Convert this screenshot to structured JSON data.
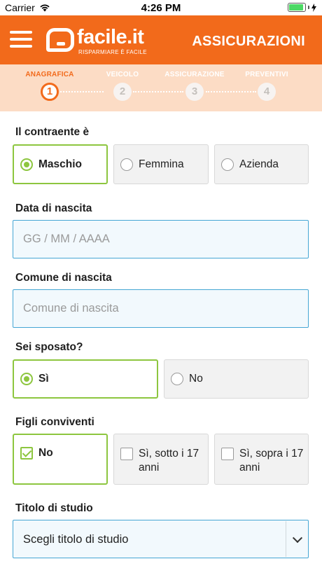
{
  "status_bar": {
    "carrier": "Carrier",
    "time": "4:26 PM",
    "battery_level": 0.9
  },
  "header": {
    "logo_text": "facile.it",
    "logo_tagline": "RISPARMIARE È FACILE",
    "title": "ASSICURAZIONI"
  },
  "stepper": {
    "steps": [
      {
        "label": "ANAGRAFICA",
        "number": "1",
        "active": true
      },
      {
        "label": "VEICOLO",
        "number": "2",
        "active": false
      },
      {
        "label": "ASSICURAZIONE",
        "number": "3",
        "active": false
      },
      {
        "label": "PREVENTIVI",
        "number": "4",
        "active": false
      }
    ]
  },
  "form": {
    "contraente": {
      "label": "Il contraente è",
      "options": [
        "Maschio",
        "Femmina",
        "Azienda"
      ],
      "selected": "Maschio"
    },
    "data_nascita": {
      "label": "Data di nascita",
      "placeholder": "GG / MM / AAAA",
      "value": ""
    },
    "comune_nascita": {
      "label": "Comune di nascita",
      "placeholder": "Comune di nascita",
      "value": ""
    },
    "sposato": {
      "label": "Sei sposato?",
      "options": [
        "Sì",
        "No"
      ],
      "selected": "Sì"
    },
    "figli": {
      "label": "Figli conviventi",
      "options": [
        "No",
        "Sì, sotto i 17 anni",
        "Sì, sopra i 17 anni"
      ],
      "selected": "No"
    },
    "titolo_studio": {
      "label": "Titolo di studio",
      "value": "Scegli titolo di studio"
    }
  },
  "colors": {
    "brand_orange": "#f26a1b",
    "selected_green": "#8dc63f",
    "input_blue": "#45a6d4"
  },
  "icons": [
    "wifi-icon",
    "battery-icon",
    "charging-icon",
    "menu-icon",
    "facile-logo-icon",
    "radio-icon",
    "checkbox-icon",
    "chevron-down-icon"
  ]
}
